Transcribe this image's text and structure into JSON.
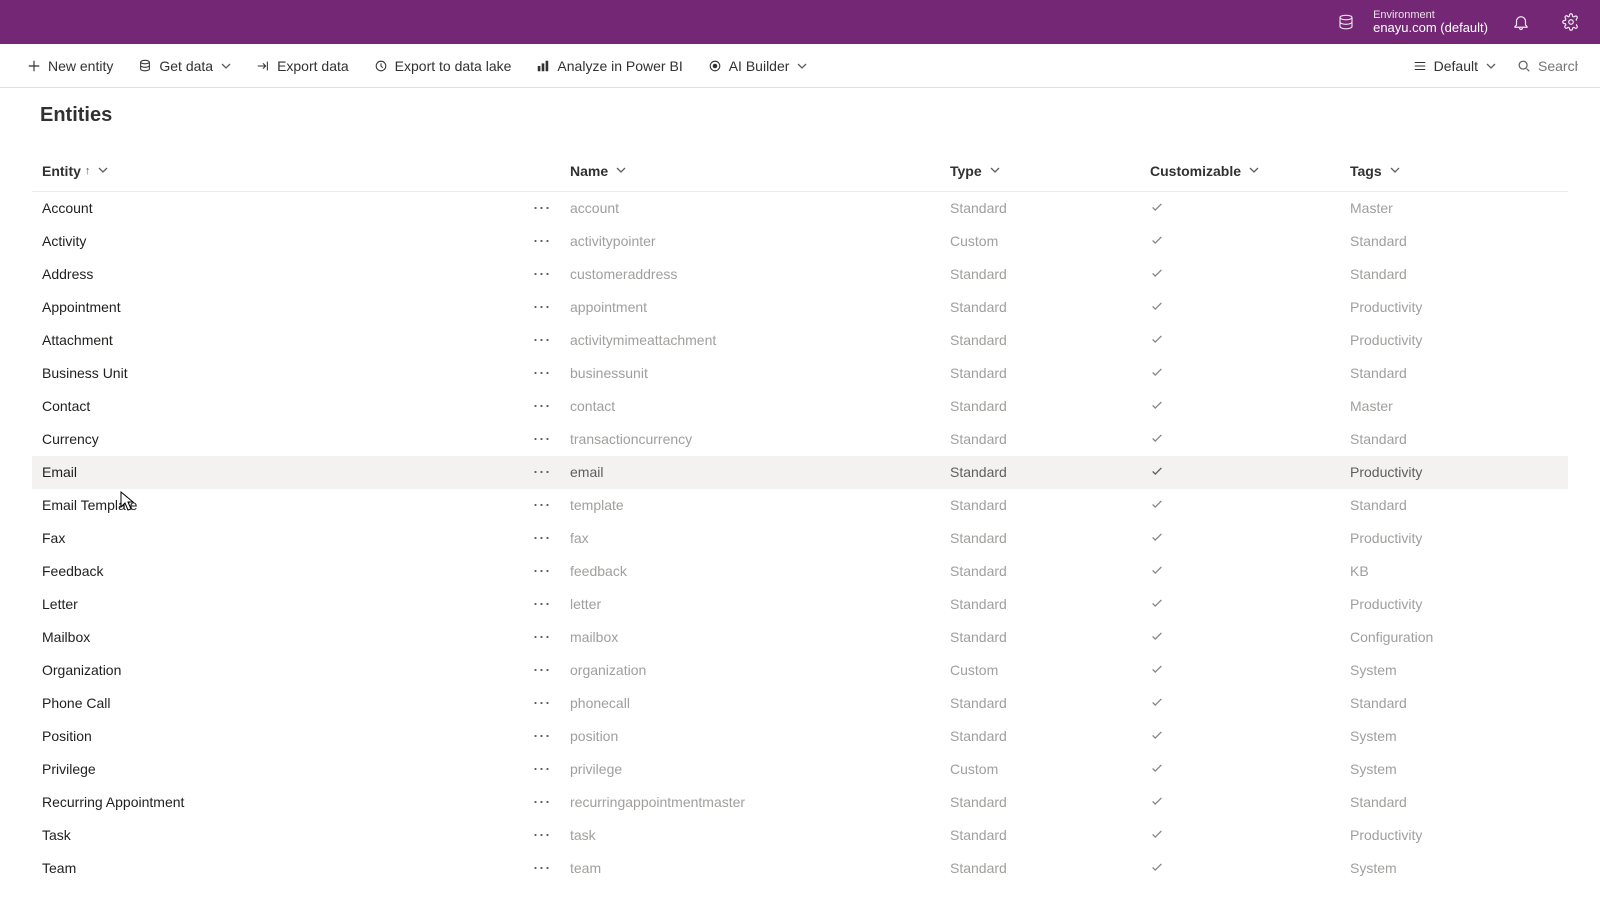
{
  "topbar": {
    "env_label": "Environment",
    "env_value": "enayu.com (default)"
  },
  "commands": {
    "new_entity": "New entity",
    "get_data": "Get data",
    "export_data": "Export data",
    "export_to_data_lake": "Export to data lake",
    "analyze_power_bi": "Analyze in Power BI",
    "ai_builder": "AI Builder"
  },
  "view_label": "Default",
  "search_placeholder": "Search",
  "page": {
    "title": "Entities"
  },
  "table": {
    "headers": {
      "entity": "Entity",
      "name": "Name",
      "type": "Type",
      "customizable": "Customizable",
      "tags": "Tags"
    },
    "rows": [
      {
        "entity": "Account",
        "name": "account",
        "type": "Standard",
        "customizable": true,
        "tag": "Master"
      },
      {
        "entity": "Activity",
        "name": "activitypointer",
        "type": "Custom",
        "customizable": true,
        "tag": "Standard"
      },
      {
        "entity": "Address",
        "name": "customeraddress",
        "type": "Standard",
        "customizable": true,
        "tag": "Standard"
      },
      {
        "entity": "Appointment",
        "name": "appointment",
        "type": "Standard",
        "customizable": true,
        "tag": "Productivity"
      },
      {
        "entity": "Attachment",
        "name": "activitymimeattachment",
        "type": "Standard",
        "customizable": true,
        "tag": "Productivity"
      },
      {
        "entity": "Business Unit",
        "name": "businessunit",
        "type": "Standard",
        "customizable": true,
        "tag": "Standard"
      },
      {
        "entity": "Contact",
        "name": "contact",
        "type": "Standard",
        "customizable": true,
        "tag": "Master"
      },
      {
        "entity": "Currency",
        "name": "transactioncurrency",
        "type": "Standard",
        "customizable": true,
        "tag": "Standard"
      },
      {
        "entity": "Email",
        "name": "email",
        "type": "Standard",
        "customizable": true,
        "tag": "Productivity",
        "hovered": true
      },
      {
        "entity": "Email Template",
        "name": "template",
        "type": "Standard",
        "customizable": true,
        "tag": "Standard"
      },
      {
        "entity": "Fax",
        "name": "fax",
        "type": "Standard",
        "customizable": true,
        "tag": "Productivity"
      },
      {
        "entity": "Feedback",
        "name": "feedback",
        "type": "Standard",
        "customizable": true,
        "tag": "KB"
      },
      {
        "entity": "Letter",
        "name": "letter",
        "type": "Standard",
        "customizable": true,
        "tag": "Productivity"
      },
      {
        "entity": "Mailbox",
        "name": "mailbox",
        "type": "Standard",
        "customizable": true,
        "tag": "Configuration"
      },
      {
        "entity": "Organization",
        "name": "organization",
        "type": "Custom",
        "customizable": true,
        "tag": "System"
      },
      {
        "entity": "Phone Call",
        "name": "phonecall",
        "type": "Standard",
        "customizable": true,
        "tag": "Standard"
      },
      {
        "entity": "Position",
        "name": "position",
        "type": "Standard",
        "customizable": true,
        "tag": "System"
      },
      {
        "entity": "Privilege",
        "name": "privilege",
        "type": "Custom",
        "customizable": true,
        "tag": "System"
      },
      {
        "entity": "Recurring Appointment",
        "name": "recurringappointmentmaster",
        "type": "Standard",
        "customizable": true,
        "tag": "Standard"
      },
      {
        "entity": "Task",
        "name": "task",
        "type": "Standard",
        "customizable": true,
        "tag": "Productivity"
      },
      {
        "entity": "Team",
        "name": "team",
        "type": "Standard",
        "customizable": true,
        "tag": "System"
      }
    ]
  }
}
